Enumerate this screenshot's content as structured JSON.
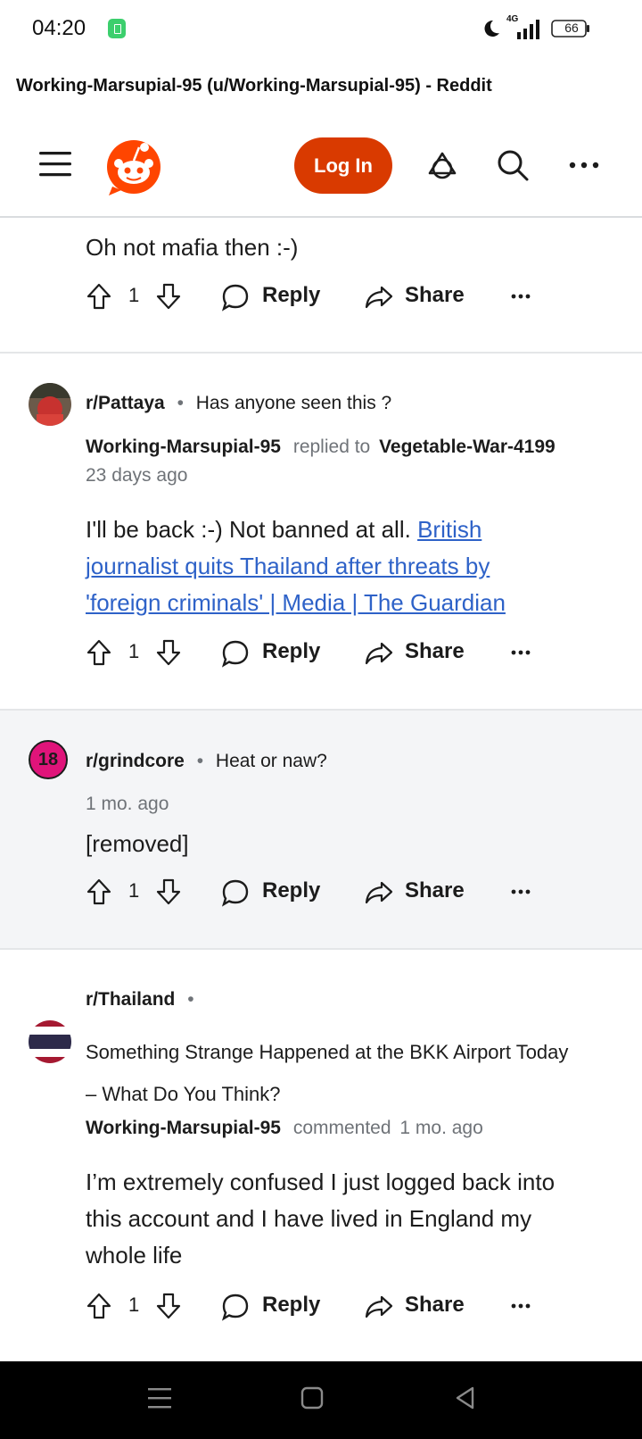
{
  "status_bar": {
    "time": "04:20",
    "network": "4G",
    "battery": "66",
    "icons": [
      "app-notification-icon",
      "moon-icon",
      "signal-icon",
      "battery-icon"
    ]
  },
  "page_title": "Working-Marsupial-95 (u/Working-Marsupial-95) - Reddit",
  "header": {
    "login_label": "Log In",
    "icons": [
      "menu-icon",
      "reddit-logo",
      "ads-icon",
      "search-icon",
      "more-icon"
    ]
  },
  "colors": {
    "brand": "#d93a00",
    "link": "#2e62c8",
    "removed_bg": "#f4f5f7"
  },
  "comments": [
    {
      "body": "Oh not mafia then :-)",
      "votes": "1",
      "reply": "Reply",
      "share": "Share"
    },
    {
      "subreddit": "r/Pattaya",
      "post_title": "Has anyone seen this ?",
      "author": "Working-Marsupial-95",
      "action": "replied to",
      "target": "Vegetable-War-4199",
      "time": "23 days ago",
      "body_prefix": "I'll be back :-) Not banned at all. ",
      "link_text": "British journalist quits Thailand after threats by 'foreign criminals' | Media | The Guardian",
      "link_line1": "British",
      "link_line2": "journalist quits Thailand after threats by",
      "link_line3": "'foreign criminals' | Media | The Guardian",
      "votes": "1",
      "reply": "Reply",
      "share": "Share"
    },
    {
      "subreddit": "r/grindcore",
      "post_title": "Heat or naw?",
      "avatar_label": "18",
      "time": "1 mo. ago",
      "body": "[removed]",
      "votes": "1",
      "reply": "Reply",
      "share": "Share"
    },
    {
      "subreddit": "r/Thailand",
      "post_title": "Something Strange Happened at the BKK Airport Today – What Do You Think?",
      "post_title_line1": "Something Strange Happened at the BKK Airport Today",
      "post_title_line2": "– What Do You Think?",
      "author": "Working-Marsupial-95",
      "action": "commented",
      "time": "1 mo. ago",
      "body": "I’m extremely confused I just logged back into this account and I have lived in England my whole life",
      "body_line1": "I’m extremely confused I just logged back into",
      "body_line2": "this account and I have lived in England my",
      "body_line3": "whole life",
      "votes": "1",
      "reply": "Reply",
      "share": "Share"
    }
  ],
  "nav_bar": {
    "icons": [
      "nav-menu-icon",
      "nav-home-icon",
      "nav-back-icon"
    ]
  }
}
